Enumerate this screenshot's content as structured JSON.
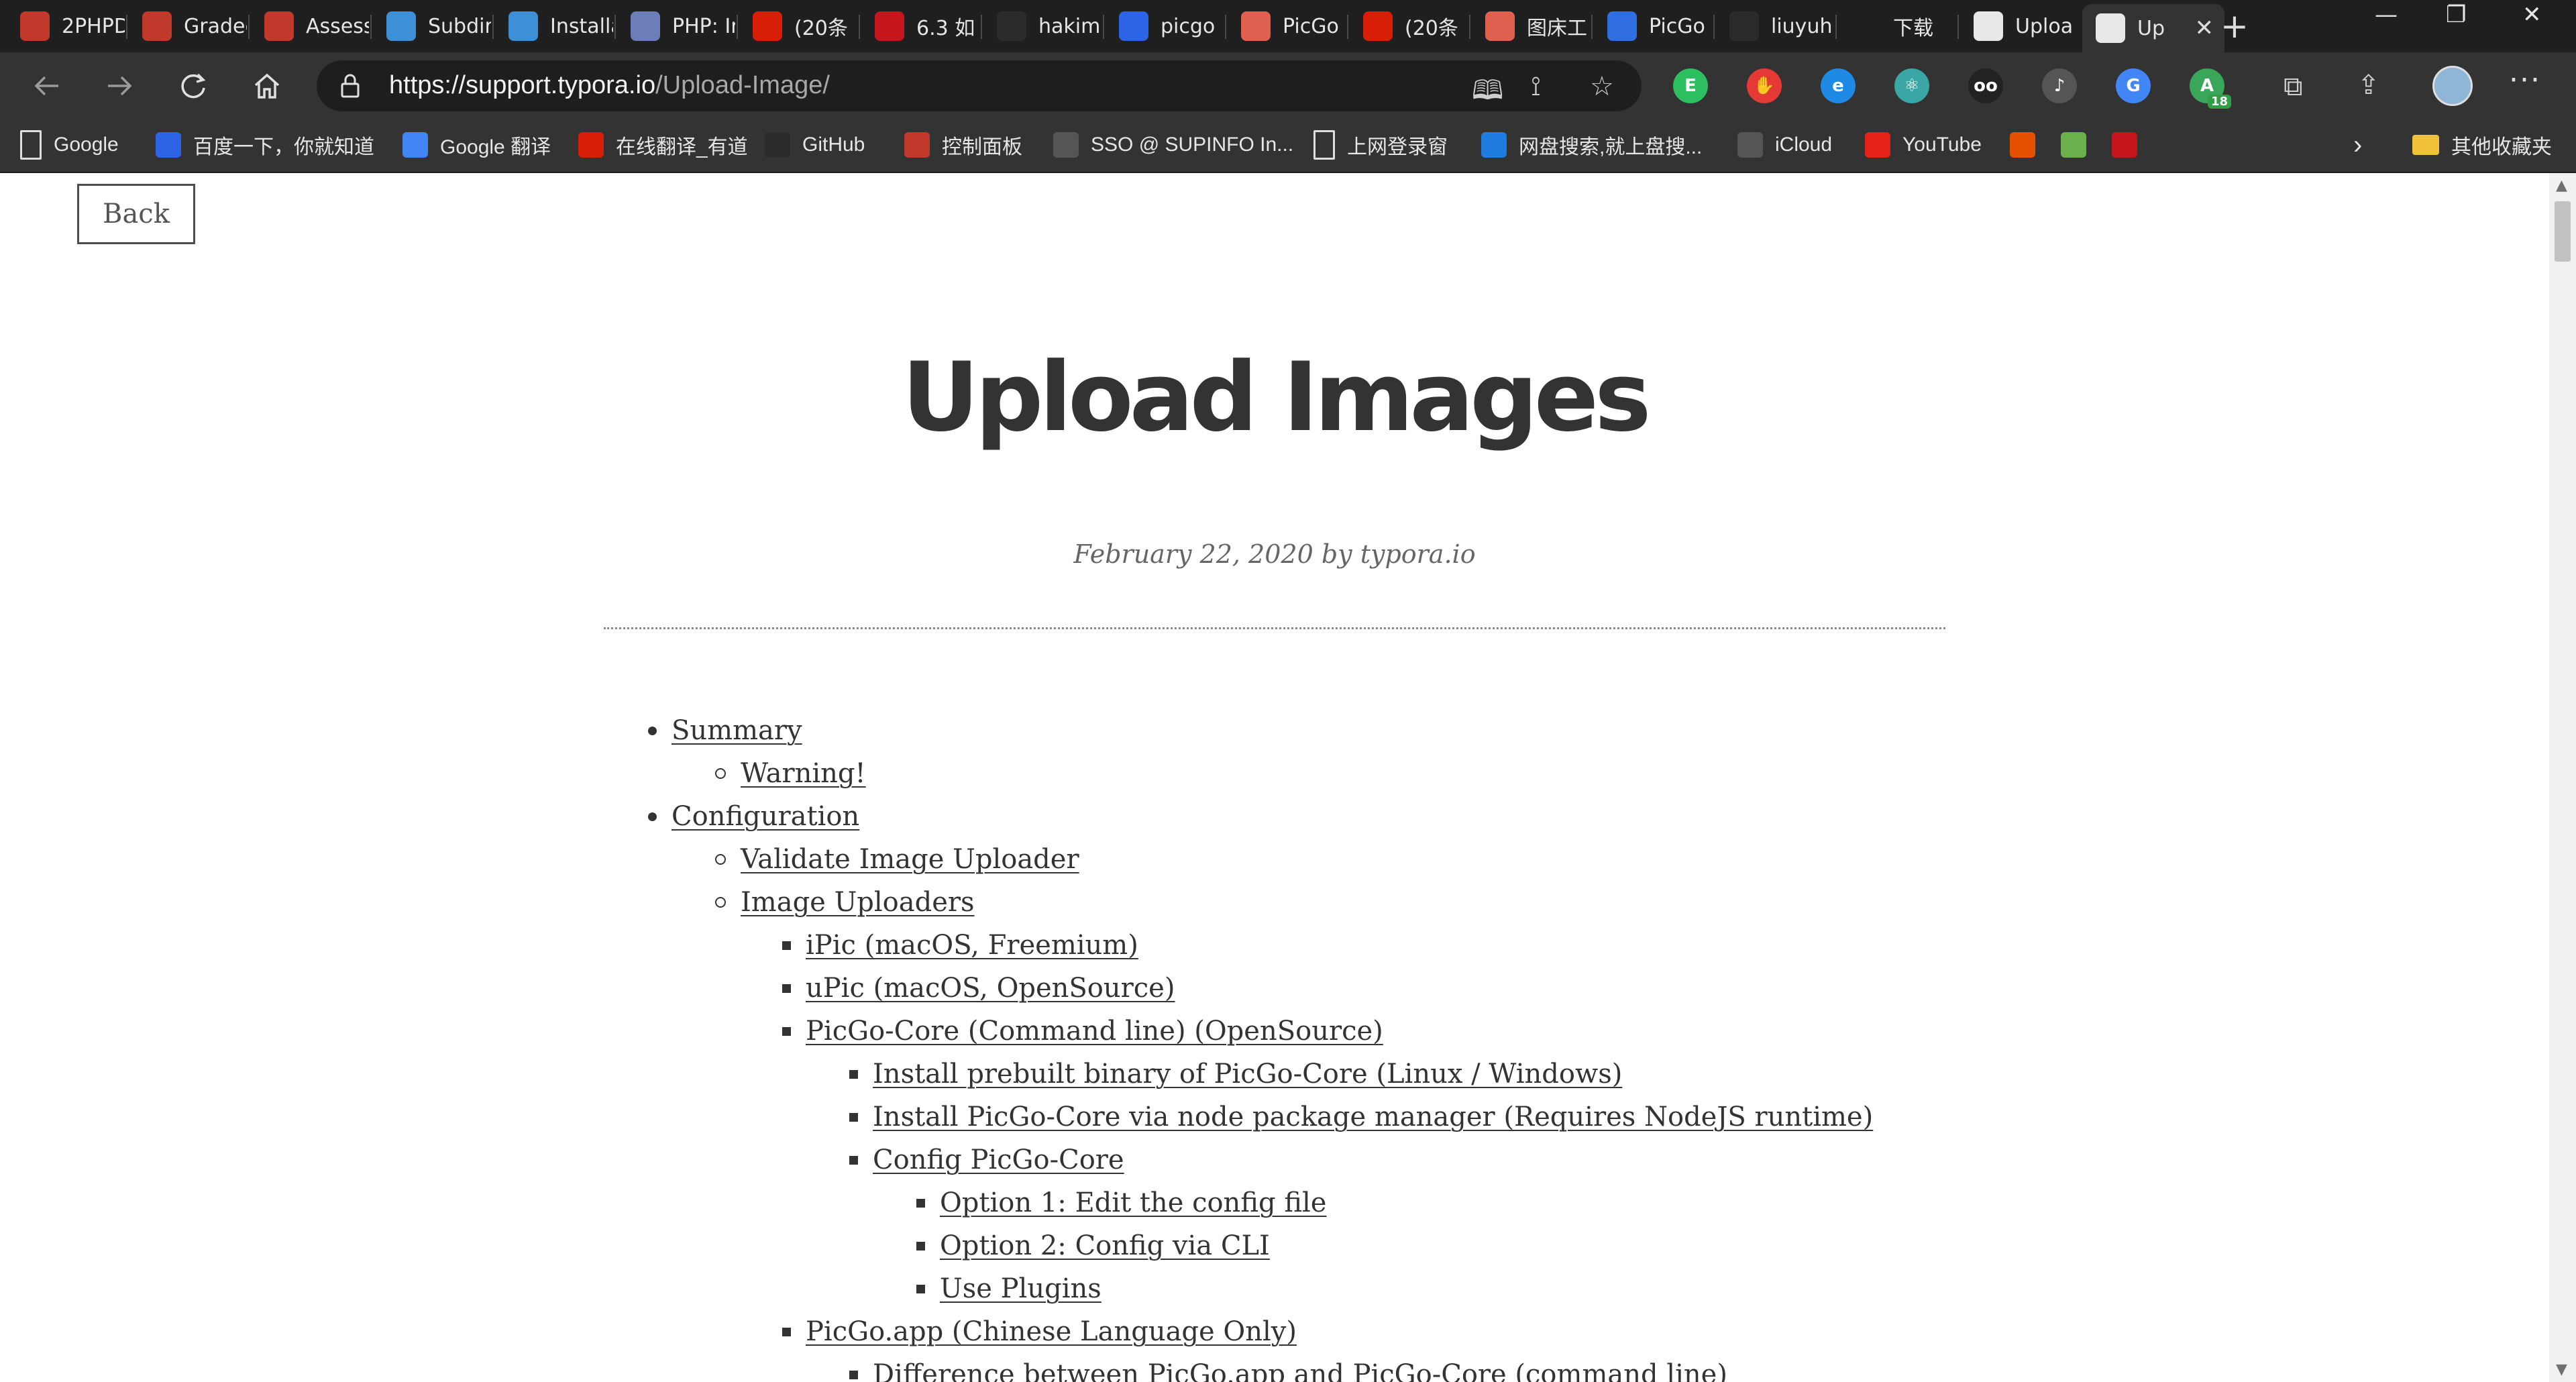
{
  "browser": {
    "tabs": [
      {
        "label": "2PHPD",
        "icon": "red-gear-icon",
        "color": "#c0392b"
      },
      {
        "label": "Gradec",
        "icon": "red-gear-icon",
        "color": "#c0392b"
      },
      {
        "label": "Assess",
        "icon": "red-gear-icon",
        "color": "#c0392b"
      },
      {
        "label": "Subdir",
        "icon": "blue-cube-icon",
        "color": "#3d8fd6"
      },
      {
        "label": "Installa",
        "icon": "blue-cube-icon",
        "color": "#3d8fd6"
      },
      {
        "label": "PHP: Ir",
        "icon": "php-icon",
        "color": "#6c7eb7"
      },
      {
        "label": "(20条",
        "icon": "csdn-icon",
        "color": "#d81e06"
      },
      {
        "label": "6.3 如",
        "icon": "pi-icon",
        "color": "#c4161c"
      },
      {
        "label": "hakim",
        "icon": "github-icon",
        "color": "#2b2b2b"
      },
      {
        "label": "picgo",
        "icon": "baidu-paw-icon",
        "color": "#2d63e5"
      },
      {
        "label": "PicGo",
        "icon": "jian-icon",
        "color": "#e0604f"
      },
      {
        "label": "(20条",
        "icon": "csdn-icon",
        "color": "#d81e06"
      },
      {
        "label": "图床工",
        "icon": "jian-icon",
        "color": "#e0604f"
      },
      {
        "label": "PicGo",
        "icon": "m-icon",
        "color": "#2f6ee0"
      },
      {
        "label": "liuyuh",
        "icon": "github-icon",
        "color": "#2b2b2b"
      },
      {
        "label": "下载",
        "icon": "download-icon",
        "color": "#1f1f1f"
      },
      {
        "label": "Uploa",
        "icon": "typora-icon",
        "color": "#e8e8e8"
      },
      {
        "label": "Up",
        "icon": "typora-icon",
        "color": "#e8e8e8",
        "active": true
      }
    ],
    "new_tab_label": "+",
    "window_controls": {
      "minimize": "—",
      "restore": "❐",
      "close": "✕"
    },
    "url_host": "https://support.typora.io",
    "url_path": "/Upload-Image/",
    "extensions": [
      {
        "name": "evernote-icon",
        "color": "#2dbe60",
        "glyph": "E"
      },
      {
        "name": "adblock-icon",
        "color": "#e53935",
        "glyph": "✋"
      },
      {
        "name": "edge-extension-icon",
        "color": "#1e88e5",
        "glyph": "e"
      },
      {
        "name": "react-devtools-icon",
        "color": "#3aa6a6",
        "glyph": "⚛"
      },
      {
        "name": "tampermonkey-icon",
        "color": "#222222",
        "glyph": "oo"
      },
      {
        "name": "page-icon",
        "color": "#555555",
        "glyph": "♪"
      },
      {
        "name": "google-translate-icon",
        "color": "#4285f4",
        "glyph": "G"
      },
      {
        "name": "android-badge-icon",
        "color": "#3aa65a",
        "glyph": "A",
        "badge": "18"
      }
    ],
    "bookmarks": [
      {
        "label": "Google",
        "icon": "page-icon",
        "color": "#333333"
      },
      {
        "label": "百度一下，你就知道",
        "icon": "baidu-paw-icon",
        "color": "#2d63e5"
      },
      {
        "label": "Google 翻译",
        "icon": "google-translate-icon",
        "color": "#4285f4"
      },
      {
        "label": "在线翻译_有道",
        "icon": "youdao-icon",
        "color": "#d81e06"
      },
      {
        "label": "GitHub",
        "icon": "github-icon",
        "color": "#2b2b2b"
      },
      {
        "label": "控制面板",
        "icon": "red-gear-icon",
        "color": "#c0392b"
      },
      {
        "label": "SSO @ SUPINFO In...",
        "icon": "sso-icon",
        "color": "#555555"
      },
      {
        "label": "上网登录窗",
        "icon": "page-icon",
        "color": "#333333"
      },
      {
        "label": "网盘搜索,就上盘搜...",
        "icon": "p-icon",
        "color": "#1e7be0"
      },
      {
        "label": "iCloud",
        "icon": "apple-icon",
        "color": "#555555"
      },
      {
        "label": "YouTube",
        "icon": "youtube-icon",
        "color": "#e62117"
      },
      {
        "label": "",
        "icon": "flame-icon",
        "color": "#e65100"
      },
      {
        "label": "",
        "icon": "circle-green-icon",
        "color": "#6ab04c"
      },
      {
        "label": "",
        "icon": "pi-icon",
        "color": "#c4161c"
      }
    ],
    "bookmarks_more": "›",
    "other_bookmarks": "其他收藏夹"
  },
  "page": {
    "back_label": "Back",
    "title": "Upload Images",
    "meta": "February 22, 2020 by typora.io",
    "toc": [
      {
        "label": "Summary",
        "level": 0
      },
      {
        "label": "Warning!",
        "level": 1
      },
      {
        "label": "Configuration",
        "level": 0
      },
      {
        "label": "Validate Image Uploader",
        "level": 1
      },
      {
        "label": "Image Uploaders",
        "level": 1
      },
      {
        "label": "iPic (macOS, Freemium)",
        "level": 2
      },
      {
        "label": "uPic (macOS, OpenSource)",
        "level": 2
      },
      {
        "label": "PicGo-Core (Command line) (OpenSource)",
        "level": 2
      },
      {
        "label": "Install prebuilt binary of PicGo-Core (Linux / Windows)",
        "level": 3
      },
      {
        "label": "Install PicGo-Core via node package manager (Requires NodeJS runtime)",
        "level": 3
      },
      {
        "label": "Config PicGo-Core",
        "level": 3
      },
      {
        "label": "Option 1: Edit the config file",
        "level": 4
      },
      {
        "label": "Option 2: Config via CLI",
        "level": 4
      },
      {
        "label": "Use Plugins",
        "level": 4
      },
      {
        "label": "PicGo.app (Chinese Language Only)",
        "level": 2
      },
      {
        "label": "Difference between PicGo.app and PicGo-Core (command line)",
        "level": 3
      }
    ]
  }
}
